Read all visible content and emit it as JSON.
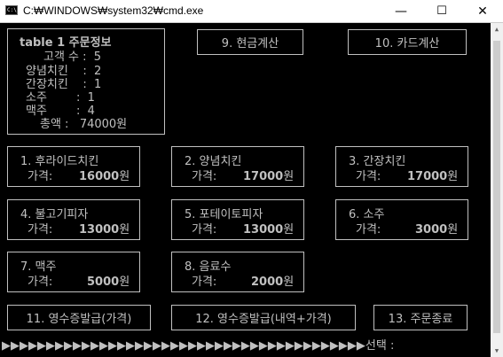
{
  "window": {
    "title": "C:₩WINDOWS₩system32₩cmd.exe",
    "icon_text": "C:\\",
    "minimize": "—",
    "maximize": "☐",
    "close": "✕"
  },
  "order_panel": {
    "heading": "table 1 주문정보",
    "guest_count": "고객 수 :  5",
    "lines": [
      "양념치킨    :  2",
      "간장치킨    :  1",
      "소주        :  1",
      "맥주        :  4"
    ],
    "total": "총액 :   74000원"
  },
  "actions": {
    "cash": "9. 현금계산",
    "card": "10. 카드계산",
    "receipt_price": "11. 영수증발급(가격)",
    "receipt_detail": "12. 영수증발급(내역+가격)",
    "end_order": "13. 주문종료"
  },
  "menu": [
    {
      "name": "1. 후라이드치킨",
      "price_label": "가격:",
      "price": "16000",
      "unit": "원"
    },
    {
      "name": "2. 양념치킨",
      "price_label": "가격:",
      "price": "17000",
      "unit": "원"
    },
    {
      "name": "3. 간장치킨",
      "price_label": "가격:",
      "price": "17000",
      "unit": "원"
    },
    {
      "name": "4. 불고기피자",
      "price_label": "가격:",
      "price": "13000",
      "unit": "원"
    },
    {
      "name": "5. 포테이토피자",
      "price_label": "가격:",
      "price": "13000",
      "unit": "원"
    },
    {
      "name": "6. 소주",
      "price_label": "가격:",
      "price": "3000",
      "unit": "원"
    },
    {
      "name": "7. 맥주",
      "price_label": "가격:",
      "price": "5000",
      "unit": "원"
    },
    {
      "name": "8. 음료수",
      "price_label": "가격:",
      "price": "2000",
      "unit": "원"
    }
  ],
  "prompt": {
    "arrows": "▶▶▶▶▶▶▶▶▶▶▶▶▶▶▶▶▶▶▶▶▶▶▶▶▶▶▶▶▶▶▶▶▶▶▶▶▶▶▶▶▶",
    "text": "선택 :"
  }
}
